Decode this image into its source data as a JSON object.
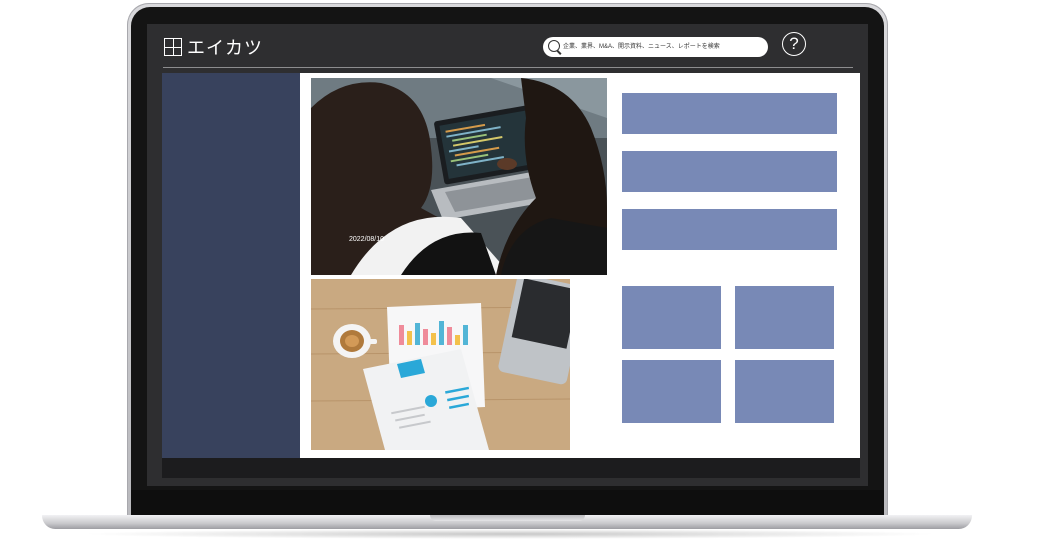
{
  "app": {
    "title": "エイカツ"
  },
  "search": {
    "placeholder": "企業、業界、M&A、開示資料、ニュース、レポートを検索"
  },
  "help": {
    "label": "?"
  },
  "news": {
    "date": "2022/08/10"
  },
  "colors": {
    "header_bg": "#2e2e30",
    "sidebar": "#38425d",
    "placeholder_block": "#7889b6",
    "content_bg": "#ffffff"
  }
}
